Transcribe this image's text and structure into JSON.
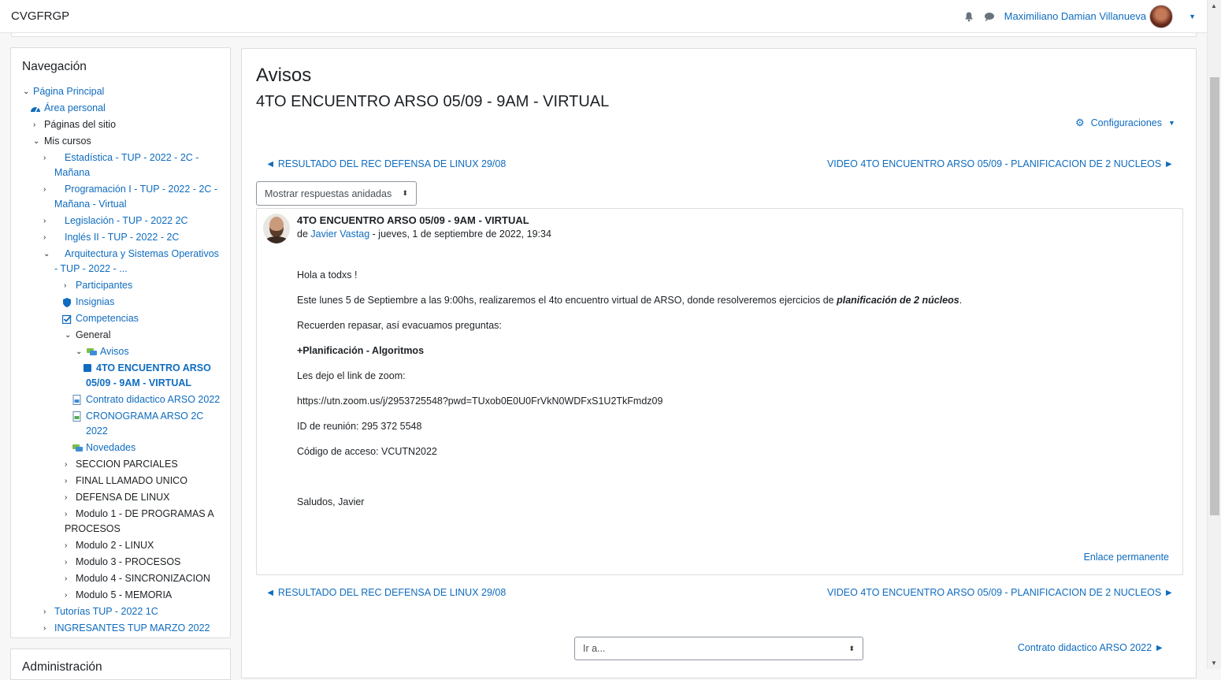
{
  "navbar": {
    "brand": "CVGFRGP",
    "user_name": "Maximiliano Damian Villanueva",
    "notifications_icon": "bell-icon",
    "messages_icon": "chat-bubble-icon"
  },
  "nav_block": {
    "title": "Navegación",
    "items": [
      {
        "label": "Página Principal",
        "link": true
      },
      {
        "label": "Área personal",
        "link": true
      },
      {
        "label": "Páginas del sitio",
        "link": false
      },
      {
        "label": "Mis cursos",
        "link": false
      },
      {
        "label": "Estadística - TUP - 2022 - 2C - Mañana",
        "link": true
      },
      {
        "label": "Programación I - TUP - 2022 - 2C - Mañana - Virtual",
        "link": true
      },
      {
        "label": "Legislación - TUP - 2022 2C",
        "link": true
      },
      {
        "label": "Inglés II - TUP - 2022 - 2C",
        "link": true
      },
      {
        "label": "Arquitectura y Sistemas Operativos - TUP - 2022 - ...",
        "link": true
      },
      {
        "label": "Participantes",
        "link": true
      },
      {
        "label": "Insignias",
        "link": true
      },
      {
        "label": "Competencias",
        "link": true
      },
      {
        "label": "General",
        "link": false
      },
      {
        "label": "Avisos",
        "link": true
      },
      {
        "label": "4TO ENCUENTRO ARSO 05/09 - 9AM - VIRTUAL",
        "link": true
      },
      {
        "label": "Contrato didactico ARSO 2022",
        "link": true
      },
      {
        "label": "CRONOGRAMA ARSO 2C 2022",
        "link": true
      },
      {
        "label": "Novedades",
        "link": true
      },
      {
        "label": "SECCION PARCIALES",
        "link": false
      },
      {
        "label": "FINAL LLAMADO UNICO",
        "link": false
      },
      {
        "label": "DEFENSA DE LINUX",
        "link": false
      },
      {
        "label": "Modulo 1 - DE PROGRAMAS A PROCESOS",
        "link": false
      },
      {
        "label": "Modulo 2 - LINUX",
        "link": false
      },
      {
        "label": "Modulo 3 - PROCESOS",
        "link": false
      },
      {
        "label": "Modulo 4 - SINCRONIZACION",
        "link": false
      },
      {
        "label": "Modulo 5 - MEMORIA",
        "link": false
      },
      {
        "label": "Tutorías TUP - 2022 1C",
        "link": true
      },
      {
        "label": "INGRESANTES TUP MARZO 2022",
        "link": true
      }
    ]
  },
  "admin_block": {
    "title": "Administración"
  },
  "main": {
    "heading": "Avisos",
    "discussion_title": "4TO ENCUENTRO ARSO 05/09 - 9AM - VIRTUAL",
    "settings_label": "Configuraciones",
    "prev_link": "◄ RESULTADO DEL REC DEFENSA DE LINUX 29/08",
    "next_link": "VIDEO 4TO ENCUENTRO ARSO 05/09 - PLANIFICACION DE 2 NUCLEOS ►",
    "display_mode": "Mostrar respuestas anidadas",
    "jump_placeholder": "Ir a...",
    "next_activity": "Contrato didactico ARSO 2022 ►"
  },
  "post": {
    "subject": "4TO ENCUENTRO ARSO 05/09 - 9AM - VIRTUAL",
    "by_prefix": "de ",
    "author": "Javier Vastag",
    "date": " - jueves, 1 de septiembre de 2022, 19:34",
    "greeting": "Hola a todxs !",
    "line1_pre": "Este lunes 5 de Septiembre a las 9:00hs, realizaremos el 4to encuentro virtual de ARSO, donde resolveremos ejercicios de ",
    "line1_em": "planificación de 2 núcleos",
    "line1_post": ".",
    "line2": "Recuerden repasar, así evacuamos preguntas:",
    "topics": "+Planificación - Algoritmos",
    "line3": "Les dejo el link de zoom:",
    "zoom_link": "https://utn.zoom.us/j/2953725548?pwd=TUxob0E0U0FrVkN0WDFxS1U2TkFmdz09",
    "meeting_id": "ID de reunión: 295 372 5548",
    "passcode": "Código de acceso: VCUTN2022",
    "signoff": "Saludos, Javier",
    "permalink": "Enlace permanente"
  }
}
